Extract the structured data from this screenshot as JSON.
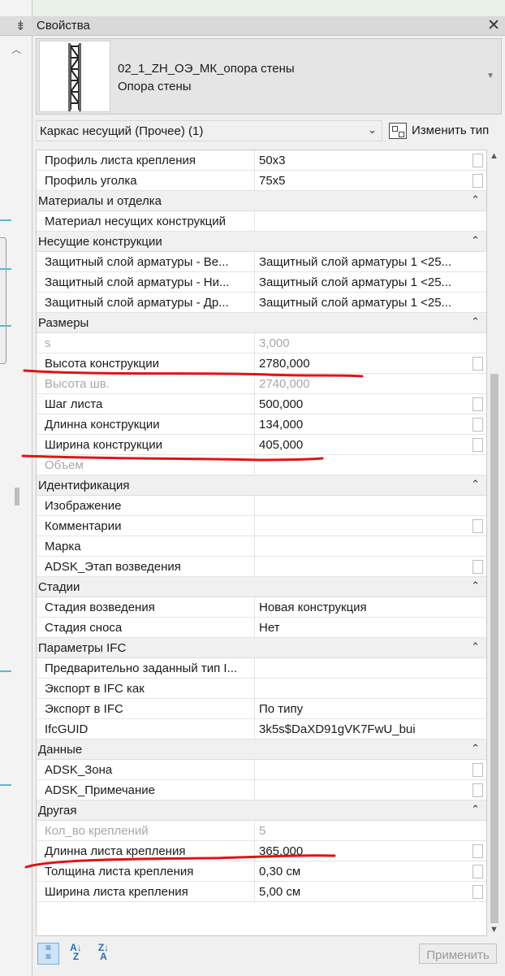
{
  "panel": {
    "title": "Свойства",
    "close_glyph": "✕"
  },
  "type_selector": {
    "family_name": "02_1_ZH_ОЭ_МК_опора стены",
    "type_name": "Опора стены"
  },
  "filter": {
    "selected": "Каркас несущий (Прочее) (1)",
    "edit_type_label": "Изменить тип"
  },
  "grid": [
    {
      "kind": "param",
      "name": "Профиль листа крепления",
      "value": "50x3",
      "check": true
    },
    {
      "kind": "param",
      "name": "Профиль уголка",
      "value": "75x5",
      "check": true
    },
    {
      "kind": "group",
      "name": "Материалы и отделка"
    },
    {
      "kind": "param",
      "name": "Материал несущих конструкций",
      "value": "",
      "check": false
    },
    {
      "kind": "group",
      "name": "Несущие конструкции"
    },
    {
      "kind": "param",
      "name": "Защитный слой арматуры - Ве...",
      "value": "Защитный слой арматуры 1 <25...",
      "check": false
    },
    {
      "kind": "param",
      "name": "Защитный слой арматуры - Ни...",
      "value": "Защитный слой арматуры 1 <25...",
      "check": false
    },
    {
      "kind": "param",
      "name": "Защитный слой арматуры - Др...",
      "value": "Защитный слой арматуры 1 <25...",
      "check": false
    },
    {
      "kind": "group",
      "name": "Размеры"
    },
    {
      "kind": "param",
      "name": "s",
      "value": "3,000",
      "check": false,
      "readonly": true
    },
    {
      "kind": "param",
      "name": "Высота конструкции",
      "value": "2780,000",
      "check": true
    },
    {
      "kind": "param",
      "name": "Высота шв.",
      "value": "2740,000",
      "check": false,
      "readonly": true
    },
    {
      "kind": "param",
      "name": "Шаг листа",
      "value": "500,000",
      "check": true
    },
    {
      "kind": "param",
      "name": "Длинна конструкции",
      "value": "134,000",
      "check": true
    },
    {
      "kind": "param",
      "name": "Ширина конструкции",
      "value": "405,000",
      "check": true
    },
    {
      "kind": "param",
      "name": "Объем",
      "value": "",
      "check": false,
      "readonly": true
    },
    {
      "kind": "group",
      "name": "Идентификация"
    },
    {
      "kind": "param",
      "name": "Изображение",
      "value": "",
      "check": false
    },
    {
      "kind": "param",
      "name": "Комментарии",
      "value": "",
      "check": true
    },
    {
      "kind": "param",
      "name": "Марка",
      "value": "",
      "check": false
    },
    {
      "kind": "param",
      "name": "ADSK_Этап возведения",
      "value": "",
      "check": true
    },
    {
      "kind": "group",
      "name": "Стадии"
    },
    {
      "kind": "param",
      "name": "Стадия возведения",
      "value": "Новая конструкция",
      "check": false
    },
    {
      "kind": "param",
      "name": "Стадия сноса",
      "value": "Нет",
      "check": false
    },
    {
      "kind": "group",
      "name": "Параметры IFC"
    },
    {
      "kind": "param",
      "name": "Предварительно заданный тип I...",
      "value": "",
      "check": false
    },
    {
      "kind": "param",
      "name": "Экспорт в IFC как",
      "value": "",
      "check": false
    },
    {
      "kind": "param",
      "name": "Экспорт в IFC",
      "value": "По типу",
      "check": false
    },
    {
      "kind": "param",
      "name": "IfcGUID",
      "value": "3k5s$DaXD91gVK7FwU_bui",
      "check": false
    },
    {
      "kind": "group",
      "name": "Данные"
    },
    {
      "kind": "param",
      "name": "ADSK_Зона",
      "value": "",
      "check": true
    },
    {
      "kind": "param",
      "name": "ADSK_Примечание",
      "value": "",
      "check": true
    },
    {
      "kind": "group",
      "name": "Другая"
    },
    {
      "kind": "param",
      "name": "Кол_во креплений",
      "value": "5",
      "check": false,
      "readonly": true
    },
    {
      "kind": "param",
      "name": "Длинна листа крепления",
      "value": "365,000",
      "check": true
    },
    {
      "kind": "param",
      "name": "Толщина листа крепления",
      "value": "0,30 см",
      "check": true
    },
    {
      "kind": "param",
      "name": "Ширина листа крепления",
      "value": "5,00 см",
      "check": true
    }
  ],
  "toolbar": {
    "apply_label": "Применить"
  },
  "colors": {
    "ink_red": "#e01414",
    "panel_bg": "#f0f0f0",
    "grid_bg": "#ffffff"
  }
}
